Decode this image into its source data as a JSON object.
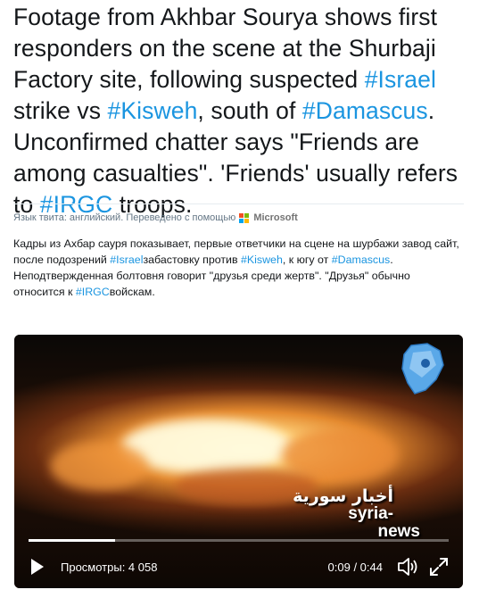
{
  "tweet": {
    "segments": [
      {
        "text": "Footage from Akhbar Sourya shows first responders on the scene at the Shurbaji Factory site, following suspected ",
        "type": "text"
      },
      {
        "text": "#Israel",
        "type": "hashtag"
      },
      {
        "text": " strike vs ",
        "type": "text"
      },
      {
        "text": "#Kisweh",
        "type": "hashtag"
      },
      {
        "text": ", south of ",
        "type": "text"
      },
      {
        "text": "#Damascus",
        "type": "hashtag"
      },
      {
        "text": ". Unconfirmed chatter says \"Friends are among casualties\". 'Friends' usually refers to ",
        "type": "text"
      },
      {
        "text": "#IRGC",
        "type": "hashtag"
      },
      {
        "text": " troops.",
        "type": "text"
      }
    ]
  },
  "translation": {
    "meta_label": "Язык твита: английский. Переведено с помощью",
    "provider": "Microsoft",
    "provider_colors": [
      "#f25022",
      "#7fba00",
      "#00a4ef",
      "#ffb900"
    ],
    "line1_segments": [
      {
        "text": "Кадры из Ахбар сауря показывает, первые ответчики на сцене на шурбажи завод сайт, после подозрений ",
        "type": "text"
      },
      {
        "text": "#Israel",
        "type": "hashtag"
      },
      {
        "text": "забастовку против ",
        "type": "text"
      },
      {
        "text": "#Kisweh",
        "type": "hashtag"
      },
      {
        "text": ", к югу от ",
        "type": "text"
      },
      {
        "text": "#Damascus",
        "type": "hashtag"
      },
      {
        "text": ".",
        "type": "text"
      }
    ],
    "line2_segments": [
      {
        "text": "Неподтвержденная болтовня говорит \"друзья среди жертв\". \"Друзья\" обычно относится к ",
        "type": "text"
      },
      {
        "text": "#IRGC",
        "type": "hashtag"
      },
      {
        "text": "войскам.",
        "type": "text"
      }
    ]
  },
  "video": {
    "watermark_arabic": "أخبار سورية",
    "watermark_latin_1": "syria-",
    "watermark_latin_2": "news",
    "map_logo_text": "أخبار سورية",
    "progress_fraction": 0.205,
    "views_label": "Просмотры: 4 058",
    "time_label": "0:09 / 0:44",
    "play_icon": "play-icon",
    "volume_icon": "volume-icon",
    "fullscreen_icon": "fullscreen-icon"
  },
  "colors": {
    "hashtag": "#1b95e0",
    "text": "#14171a",
    "meta": "#657786"
  }
}
